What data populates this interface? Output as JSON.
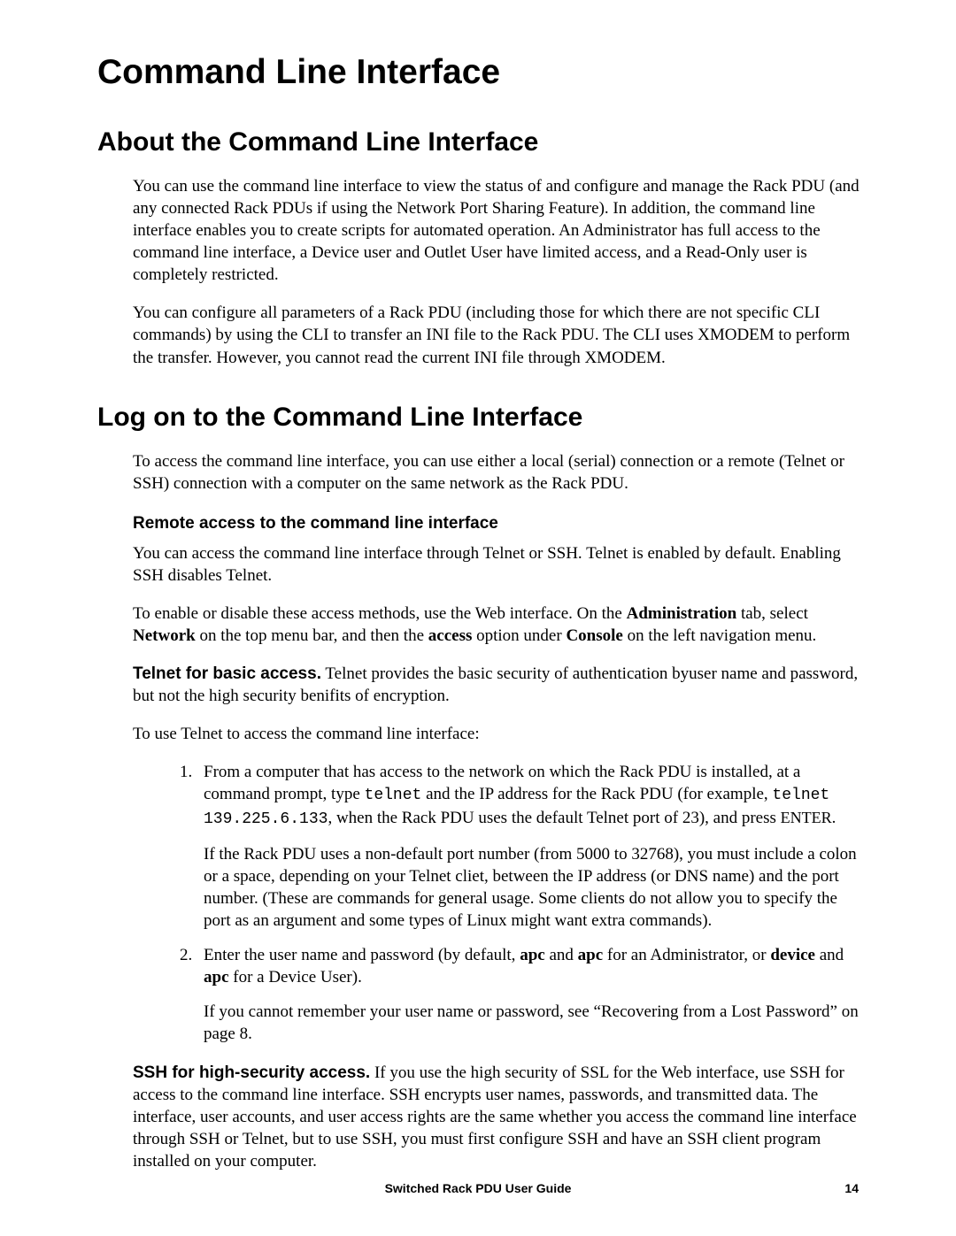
{
  "title": "Command Line Interface",
  "section1": {
    "heading": "About the Command Line Interface",
    "p1": "You can use the command line interface to view the status of and configure and manage the Rack PDU (and any connected Rack PDUs if using the Network Port Sharing Feature). In addition, the command line interface enables you to create scripts for automated operation. An Administrator has full access to the command line interface, a Device user and Outlet User have limited access, and a Read-Only user is completely restricted.",
    "p2": "You can configure all parameters of a Rack PDU (including those for which there are not specific CLI commands) by using the CLI to transfer an INI file to the Rack PDU. The CLI uses XMODEM to perform the transfer. However, you cannot read the current INI file through XMODEM."
  },
  "section2": {
    "heading": "Log on to the Command Line Interface",
    "p1": "To access the command line interface, you can use either a local (serial) connection or a remote (Telnet or SSH) connection with a computer on the same network as the Rack PDU.",
    "sub": {
      "heading": "Remote access to the command line interface",
      "p1": "You can access the command line interface through Telnet or SSH. Telnet is enabled by default. Enabling SSH disables Telnet.",
      "p2_pre": "To enable or disable these access methods, use the Web interface. On the ",
      "p2_b1": "Administration",
      "p2_mid1": " tab, select ",
      "p2_b2": "Network",
      "p2_mid2": " on the top menu bar, and then the ",
      "p2_b3": "access",
      "p2_mid3": " option under ",
      "p2_b4": "Console",
      "p2_post": " on the left navigation menu.",
      "p3_label": "Telnet for basic access.",
      "p3_text": " Telnet provides the basic security of authentication byuser name and password, but not the high security benifits of encryption.",
      "p4": "To use Telnet to access the command line interface:",
      "li1_a": "From a computer that has access to the network on which the Rack PDU is installed, at a command prompt, type ",
      "li1_code1": "telnet",
      "li1_b": " and the IP address for the Rack PDU (for example, ",
      "li1_code2": "telnet 139.225.6.133",
      "li1_c": ", when the Rack PDU uses the default Telnet port of 23), and press ",
      "li1_enter": "ENTER",
      "li1_d": ".",
      "li1_p2": "If the Rack PDU uses a non-default port number (from 5000 to 32768), you must include a colon or a space, depending on your Telnet cliet, between the IP address (or DNS name) and the port number. (These are commands for general usage. Some clients do not allow you to specify the port as an argument and some types of Linux might want extra commands).",
      "li2_a": "Enter the user name and password (by default, ",
      "li2_b1": "apc",
      "li2_b": " and ",
      "li2_b2": "apc",
      "li2_c": " for an Administrator, or ",
      "li2_b3": "device",
      "li2_d": " and ",
      "li2_b4": "apc",
      "li2_e": " for a Device User).",
      "li2_p2": "If you cannot remember your user name or password, see “Recovering from a Lost Password” on page 8.",
      "p5_label": "SSH for high-security access.",
      "p5_text": " If you use the high security of SSL for the Web interface, use SSH for access to the command line interface. SSH encrypts user names, passwords, and transmitted data. The interface, user accounts, and user access rights are the same whether you access the command line interface through SSH or Telnet, but to use SSH, you must first configure SSH and have an SSH client program installed on your computer."
    }
  },
  "footer": {
    "title": "Switched Rack PDU User Guide",
    "page": "14"
  }
}
